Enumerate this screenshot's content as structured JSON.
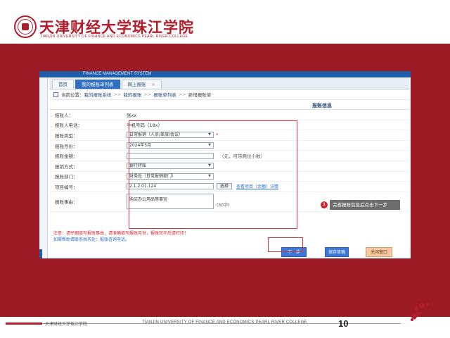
{
  "header": {
    "university_name_cn": "天津财经大学珠江学院",
    "university_name_en": "TIANJIN UNIVERSITY OF FINANCE AND ECONOMICS PEARL RIVER COLLEGE"
  },
  "system": {
    "title": "FINANCE MANAGEMENT SYSTEM"
  },
  "tabs": [
    {
      "label": "首页"
    },
    {
      "label": "我的报账单列表"
    },
    {
      "label": "网上报账",
      "close": "×"
    }
  ],
  "breadcrumb": {
    "prefix": "当前位置：",
    "items": [
      "我的报账系统",
      "我的报账",
      "报账单列表",
      "新增报账单"
    ],
    "separator": ">>"
  },
  "form": {
    "title": "报账信息",
    "rows": [
      {
        "label": "报账人：",
        "value": "张xx"
      },
      {
        "label": "报账人电话：",
        "value": "手机号码（18x）"
      },
      {
        "label": "报账类型：",
        "select": "日常报销（人员/差旅/会议）",
        "required": "*"
      },
      {
        "label": "报账月份：",
        "select": "2024年5月"
      },
      {
        "label": "报账金额：",
        "input": "",
        "hint": "（元，可带两位小数）"
      },
      {
        "label": "报销方式：",
        "select": "银行转账"
      },
      {
        "label": "报账部门：",
        "select": "财务处（日常报销部门）"
      },
      {
        "label": "项目编号：",
        "input": "2.1.2.01.124",
        "button": "选择",
        "link": "查看项目（余额）详情"
      },
      {
        "label": "报账事由：",
        "textarea": "购买办公用品等事宜",
        "limit": "(50字)"
      }
    ]
  },
  "notes": {
    "red": "注意：请仔细填写报账事由，请准确填写报账月份，报账完毕后请打印！",
    "blue": "如需帮助请联系财务处：报账咨询电话。"
  },
  "actions": {
    "next": "下一步",
    "save": "保存草稿",
    "close": "关闭窗口"
  },
  "callout": {
    "number": "1",
    "text": "完善报账信息后点击下一步"
  },
  "footer": {
    "cn": "天津财经大学珠江学院",
    "en": "TIANJIN UNIVERSITY OF FINANCE AND ECONOMICS PEARL RIVER COLLEGE",
    "page_number": "10"
  },
  "colors": {
    "brand_red": "#9b1a24",
    "accent_blue": "#3b78d8",
    "annotation_red": "#e0313b"
  }
}
